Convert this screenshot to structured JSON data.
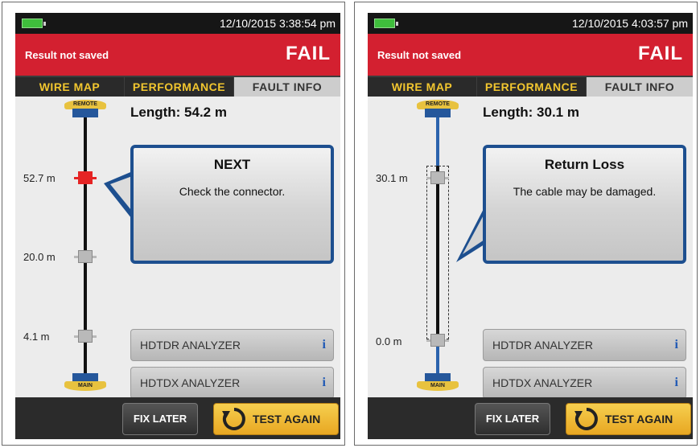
{
  "panels": [
    {
      "datetime": "12/10/2015 3:38:54 pm",
      "result_status": "Result not saved",
      "result": "FAIL",
      "tabs": [
        "WIRE MAP",
        "PERFORMANCE",
        "FAULT INFO"
      ],
      "active_tab": "FAULT INFO",
      "length": "Length:  54.2 m",
      "remote_label": "REMOTE",
      "main_label": "MAIN",
      "markers": [
        "52.7 m",
        "20.0 m",
        "4.1 m"
      ],
      "fault_title": "NEXT",
      "fault_message": "Check the connector.",
      "analyzers": [
        "HDTDR ANALYZER",
        "HDTDX ANALYZER"
      ],
      "info_icon": "i",
      "fix_later": "FIX LATER",
      "test_again": "TEST AGAIN"
    },
    {
      "datetime": "12/10/2015 4:03:57 pm",
      "result_status": "Result not saved",
      "result": "FAIL",
      "tabs": [
        "WIRE MAP",
        "PERFORMANCE",
        "FAULT INFO"
      ],
      "active_tab": "FAULT INFO",
      "length": "Length:  30.1 m",
      "remote_label": "REMOTE",
      "main_label": "MAIN",
      "markers": [
        "30.1 m",
        "0.0 m"
      ],
      "fault_title": "Return Loss",
      "fault_message": "The cable may be damaged.",
      "analyzers": [
        "HDTDR ANALYZER",
        "HDTDX ANALYZER"
      ],
      "info_icon": "i",
      "fix_later": "FIX LATER",
      "test_again": "TEST AGAIN"
    }
  ],
  "colors": {
    "fail_bar": "#d32030",
    "tab_text": "#f2c62f",
    "callout_border": "#1d4f8f",
    "test_again_button": "#f0bb3a",
    "battery": "#3fbe3c"
  }
}
